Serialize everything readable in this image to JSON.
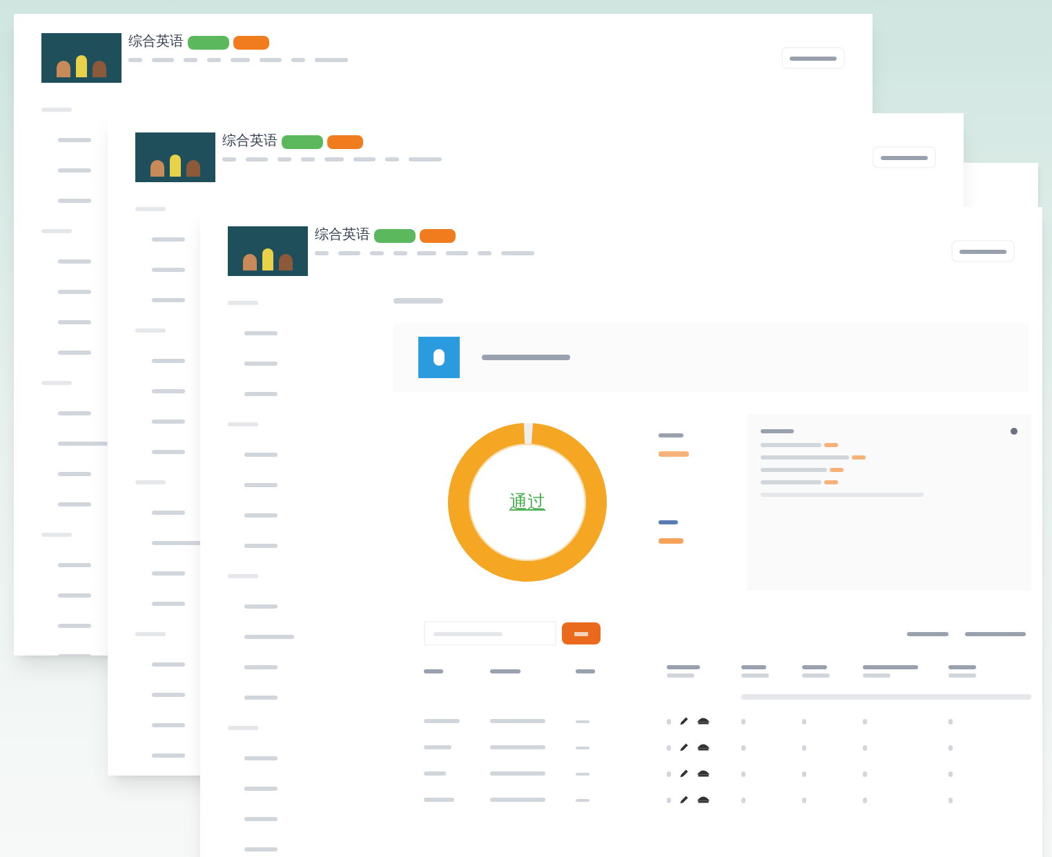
{
  "windows": [
    {
      "course_title": "综合英语"
    },
    {
      "course_title": "综合英语"
    },
    {
      "course_title": "综合英语"
    }
  ],
  "result": {
    "label": "通过",
    "level": 0.98
  }
}
